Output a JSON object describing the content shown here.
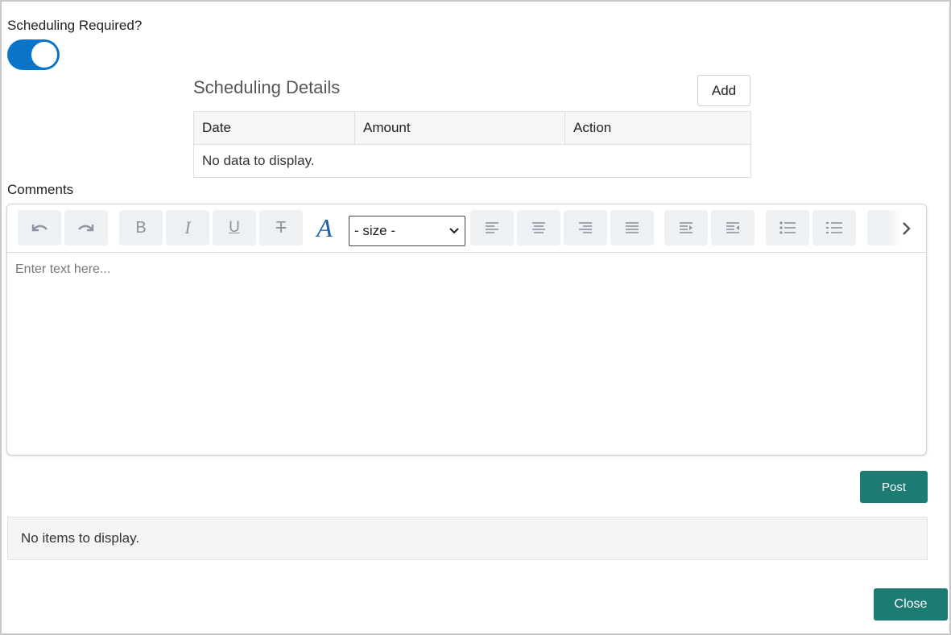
{
  "scheduling": {
    "required_label": "Scheduling Required?",
    "toggle_on": true,
    "title": "Scheduling Details",
    "add_label": "Add",
    "columns": [
      "Date",
      "Amount",
      "Action"
    ],
    "empty_text": "No data to display."
  },
  "comments": {
    "label": "Comments",
    "size_select_value": "- size -",
    "placeholder": "Enter text here...",
    "toolbar_icons": [
      "undo-icon",
      "redo-icon",
      "bold-icon",
      "italic-icon",
      "underline-icon",
      "strikethrough-icon",
      "font-color-icon",
      "align-left-icon",
      "align-center-icon",
      "align-right-icon",
      "justify-icon",
      "indent-icon",
      "outdent-icon",
      "bullet-list-icon",
      "numbered-list-icon"
    ],
    "toolbar_glyphs": {
      "bold": "B",
      "italic": "I",
      "underline": "U",
      "strike": "T",
      "font_color": "A"
    },
    "post_label": "Post"
  },
  "posts": {
    "empty_text": "No items to display."
  },
  "footer": {
    "close_label": "Close"
  },
  "colors": {
    "toggle": "#0a74c9",
    "primary_button": "#1c7b72",
    "font_color_icon": "#1f5fa8"
  }
}
